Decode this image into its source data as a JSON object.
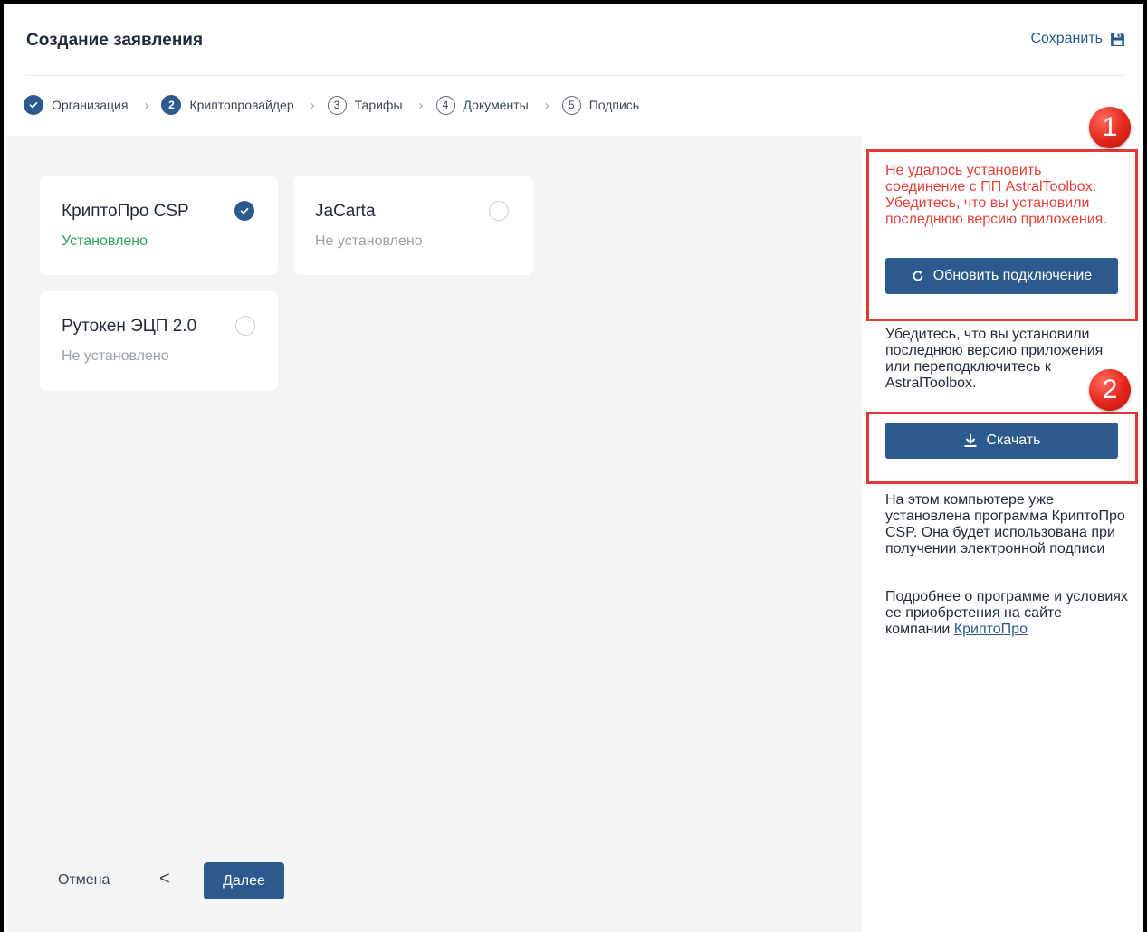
{
  "header": {
    "title": "Создание заявления",
    "save_label": "Сохранить"
  },
  "stepper": {
    "steps": [
      {
        "number": "✓",
        "label": "Организация",
        "state": "done"
      },
      {
        "number": "2",
        "label": "Криптопровайдер",
        "state": "active"
      },
      {
        "number": "3",
        "label": "Тарифы",
        "state": "todo"
      },
      {
        "number": "4",
        "label": "Документы",
        "state": "todo"
      },
      {
        "number": "5",
        "label": "Подпись",
        "state": "todo"
      }
    ],
    "separator": "›"
  },
  "providers": [
    {
      "name": "КриптоПро CSP",
      "status": "Установлено",
      "selected": true
    },
    {
      "name": "JaCarta",
      "status": "Не установлено",
      "selected": false
    },
    {
      "name": "Рутокен ЭЦП 2.0",
      "status": "Не установлено",
      "selected": false
    }
  ],
  "footer": {
    "cancel_label": "Отмена",
    "back_label": "<",
    "next_label": "Далее"
  },
  "side_panel": {
    "error_text": "Не удалось установить соединение с ПП AstralToolbox. Убедитесь, что вы установили последнюю версию приложения.",
    "refresh_label": "Обновить подключение",
    "info_text_1": "Убедитесь, что вы установили последнюю версию приложения или переподключитесь к AstralToolbox.",
    "download_label": "Скачать",
    "info_text_2": "На этом компьютере уже установлена программа КриптоПро CSP. Она будет использована при получении электронной подписи",
    "info_text_3_prefix": "Подробнее о программе и условиях ее приобретения на сайте компании ",
    "info_link": "КриптоПро"
  },
  "annotations": {
    "callout_1": "1",
    "callout_2": "2"
  },
  "colors": {
    "primary": "#2d5a8e",
    "error": "#e24038",
    "success": "#2da35a",
    "callout": "#e53935"
  }
}
